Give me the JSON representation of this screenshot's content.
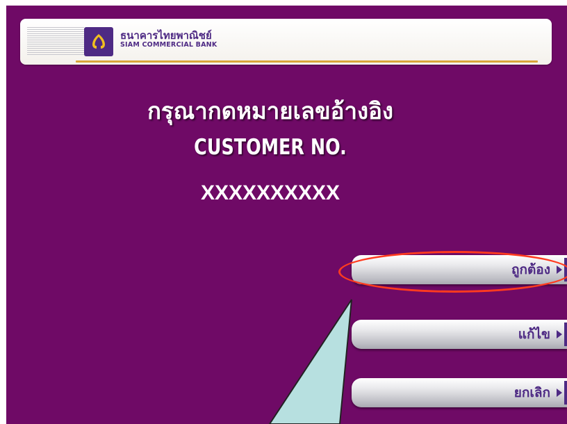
{
  "header": {
    "bank_name_thai": "ธนาคารไทยพาณิชย์",
    "bank_name_english": "SIAM COMMERCIAL BANK"
  },
  "main": {
    "title_thai": "กรุณากดหมายเลขอ้างอิง",
    "title_english": "CUSTOMER NO.",
    "customer_number": "XXXXXXXXXX"
  },
  "buttons": [
    {
      "label": "ถูกต้อง"
    },
    {
      "label": "แก้ไข"
    },
    {
      "label": "ยกเลิก"
    }
  ],
  "colors": {
    "screen_background": "#6f0a66",
    "brand_purple": "#4e2a84",
    "highlight_red": "#ff3b1f",
    "callout_fill": "#b7e0e0"
  },
  "icons": [
    "scb-logo-icon",
    "play-arrow-icon"
  ]
}
